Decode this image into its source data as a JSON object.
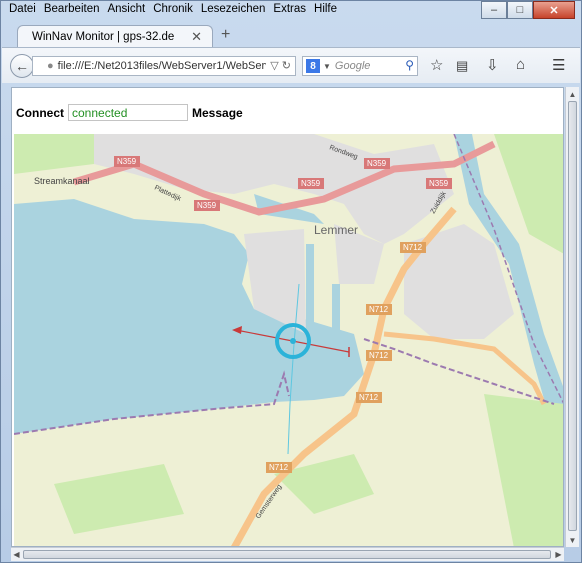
{
  "menubar": {
    "items": [
      {
        "label": "Datei"
      },
      {
        "label": "Bearbeiten"
      },
      {
        "label": "Ansicht"
      },
      {
        "label": "Chronik"
      },
      {
        "label": "Lesezeichen"
      },
      {
        "label": "Extras"
      },
      {
        "label": "Hilfe"
      }
    ]
  },
  "window": {
    "minimize": "–",
    "maximize": "□",
    "close": "✕"
  },
  "tab": {
    "title": "WinNav Monitor | gps-32.de",
    "close": "✕",
    "new_tab": "+"
  },
  "nav": {
    "url": "file:///E:/Net2013files/WebServer1/WebServe",
    "search_placeholder": "Google",
    "search_engine_icon": "google-icon",
    "icons": [
      "star-icon",
      "reading-list-icon",
      "download-icon",
      "home-icon",
      "menu-icon"
    ]
  },
  "page": {
    "connect_label": "Connect",
    "connect_value": "connected",
    "message_label": "Message",
    "connect_value_color": "#239023"
  },
  "map": {
    "place_names": [
      "Lemmer",
      "Streamkanaal",
      "Plattedijk",
      "Rondweg",
      "Zuiddijk",
      "Gemsterweg"
    ],
    "road_labels": [
      "N359",
      "N359",
      "N359",
      "N359",
      "N359",
      "N712",
      "N712",
      "N712",
      "N712",
      "N712"
    ],
    "colors": {
      "water": "#aad3df",
      "land": "#f2efe9",
      "residential": "#e0dfdf",
      "farmland": "#eef0d5",
      "meadow": "#cdebb0",
      "motorway_pink": "#e89a9a",
      "primary_orange": "#f7c48a",
      "boat_marker": "#2bb3d9",
      "heading_vector": "#c93a3a"
    }
  }
}
